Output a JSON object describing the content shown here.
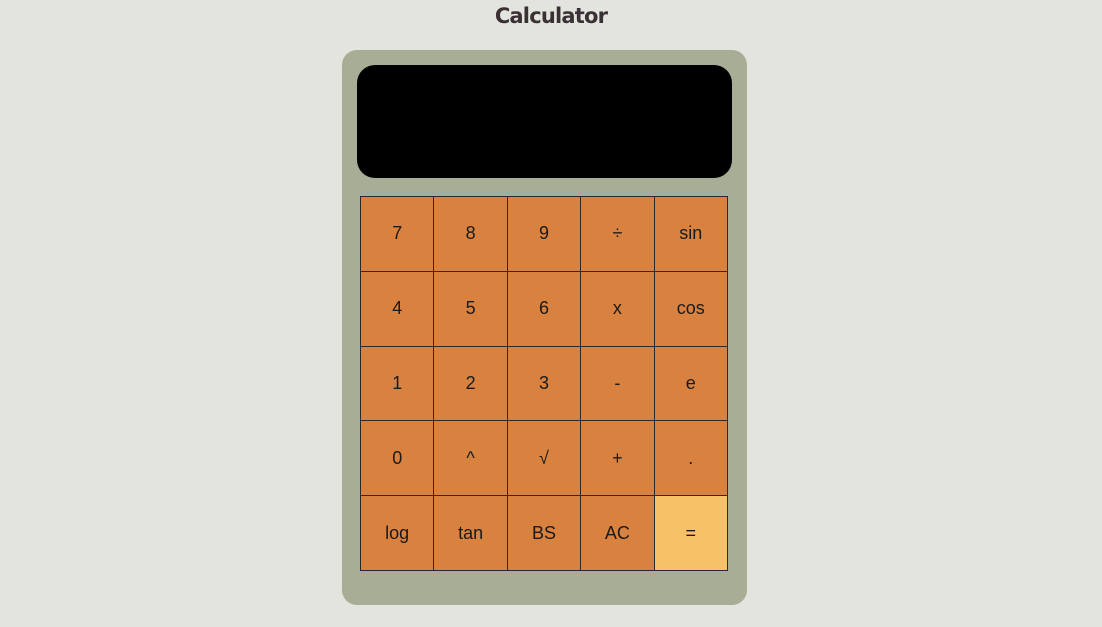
{
  "page": {
    "title": "Calculator"
  },
  "display": {
    "value": ""
  },
  "colors": {
    "background": "#e3e4dd",
    "body": "#a7ae95",
    "display": "#000000",
    "key": "#d98240",
    "equals_key": "#f7c168"
  },
  "keys": [
    {
      "label": "7",
      "name": "key-7"
    },
    {
      "label": "8",
      "name": "key-8"
    },
    {
      "label": "9",
      "name": "key-9"
    },
    {
      "label": "÷",
      "name": "divide-button"
    },
    {
      "label": "sin",
      "name": "sin-button"
    },
    {
      "label": "4",
      "name": "key-4"
    },
    {
      "label": "5",
      "name": "key-5"
    },
    {
      "label": "6",
      "name": "key-6"
    },
    {
      "label": "x",
      "name": "multiply-button"
    },
    {
      "label": "cos",
      "name": "cos-button"
    },
    {
      "label": "1",
      "name": "key-1"
    },
    {
      "label": "2",
      "name": "key-2"
    },
    {
      "label": "3",
      "name": "key-3"
    },
    {
      "label": "-",
      "name": "subtract-button"
    },
    {
      "label": "e",
      "name": "e-button"
    },
    {
      "label": "0",
      "name": "key-0"
    },
    {
      "label": "^",
      "name": "power-button"
    },
    {
      "label": "√",
      "name": "sqrt-button"
    },
    {
      "label": "+",
      "name": "add-button"
    },
    {
      "label": ".",
      "name": "decimal-button"
    },
    {
      "label": "log",
      "name": "log-button"
    },
    {
      "label": "tan",
      "name": "tan-button"
    },
    {
      "label": "BS",
      "name": "backspace-button"
    },
    {
      "label": "AC",
      "name": "all-clear-button"
    },
    {
      "label": "=",
      "name": "equals-button"
    }
  ]
}
